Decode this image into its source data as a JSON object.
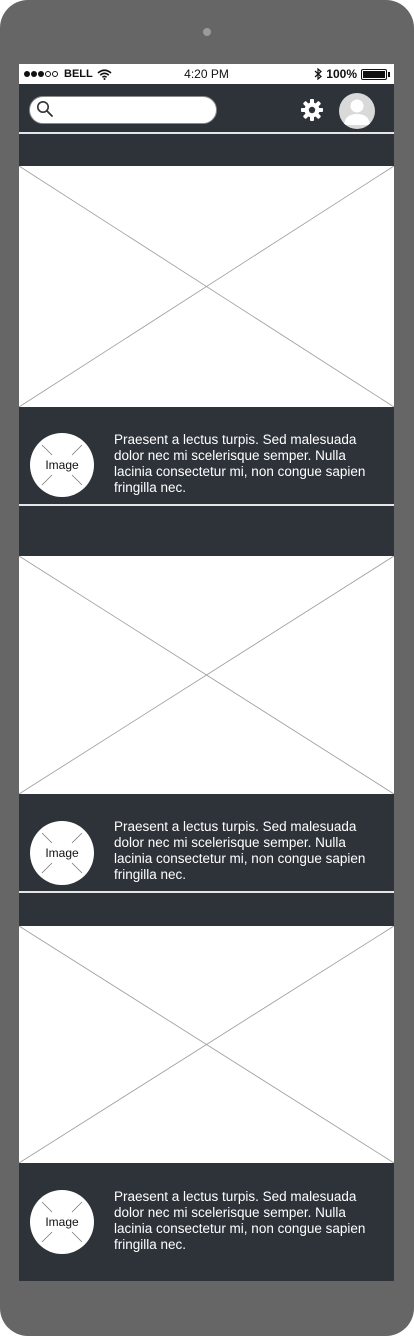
{
  "status_bar": {
    "carrier": "BELL",
    "time": "4:20 PM",
    "battery": "100%",
    "battery_level": 1.0
  },
  "header": {
    "search_placeholder": "",
    "icons": [
      "search-icon",
      "gear-icon",
      "user-avatar-icon"
    ]
  },
  "feed": {
    "items": [
      {
        "image_label": "Image",
        "text": "Praesent a lectus turpis. Sed malesuada dolor nec mi scelerisque semper. Nulla lacinia consectetur mi, non congue sapien fringilla nec."
      },
      {
        "image_label": "Image",
        "text": "Praesent a lectus turpis. Sed malesuada dolor nec mi scelerisque semper. Nulla lacinia consectetur mi, non congue sapien fringilla nec."
      },
      {
        "image_label": "Image",
        "text": "Praesent a lectus turpis. Sed malesuada dolor nec mi scelerisque semper. Nulla lacinia consectetur mi, non congue sapien fringilla nec."
      }
    ]
  },
  "colors": {
    "device_frame": "#666666",
    "screen_background": "#2e333a",
    "placeholder_background": "#ffffff"
  }
}
